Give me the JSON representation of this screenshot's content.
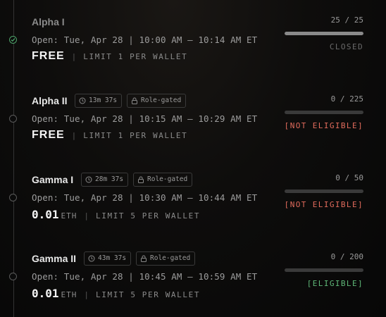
{
  "phases": [
    {
      "name": "Alpha I",
      "open": "Open: Tue, Apr 28 | 10:00 AM – 10:14 AM ET",
      "price": "FREE",
      "currency": "",
      "separator": "|",
      "limit": "LIMIT 1 PER WALLET",
      "count": "25 / 25",
      "progress": 1.0,
      "status": "CLOSED"
    },
    {
      "name": "Alpha II",
      "timer": "13m 37s",
      "access": "Role-gated",
      "open": "Open: Tue, Apr 28 | 10:15 AM – 10:29 AM ET",
      "price": "FREE",
      "currency": "",
      "separator": "|",
      "limit": "LIMIT 1 PER WALLET",
      "count": "0 / 225",
      "progress": 0,
      "status": "[NOT ELIGIBLE]"
    },
    {
      "name": "Gamma I",
      "timer": "28m 37s",
      "access": "Role-gated",
      "open": "Open: Tue, Apr 28 | 10:30 AM – 10:44 AM ET",
      "price": "0.01",
      "currency": "ETH",
      "separator": "|",
      "limit": "LIMIT 5 PER WALLET",
      "count": "0 / 50",
      "progress": 0,
      "status": "[NOT ELIGIBLE]"
    },
    {
      "name": "Gamma II",
      "timer": "43m 37s",
      "access": "Role-gated",
      "open": "Open: Tue, Apr 28 | 10:45 AM – 10:59 AM ET",
      "price": "0.01",
      "currency": "ETH",
      "separator": "|",
      "limit": "LIMIT 5 PER WALLET",
      "count": "0 / 200",
      "progress": 0,
      "status": "[ELIGIBLE]"
    }
  ],
  "colors": {
    "closed": "#6b6b6b",
    "not_eligible": "#e26b5c",
    "eligible": "#5fb878",
    "done_dot": "#4ea36a"
  }
}
